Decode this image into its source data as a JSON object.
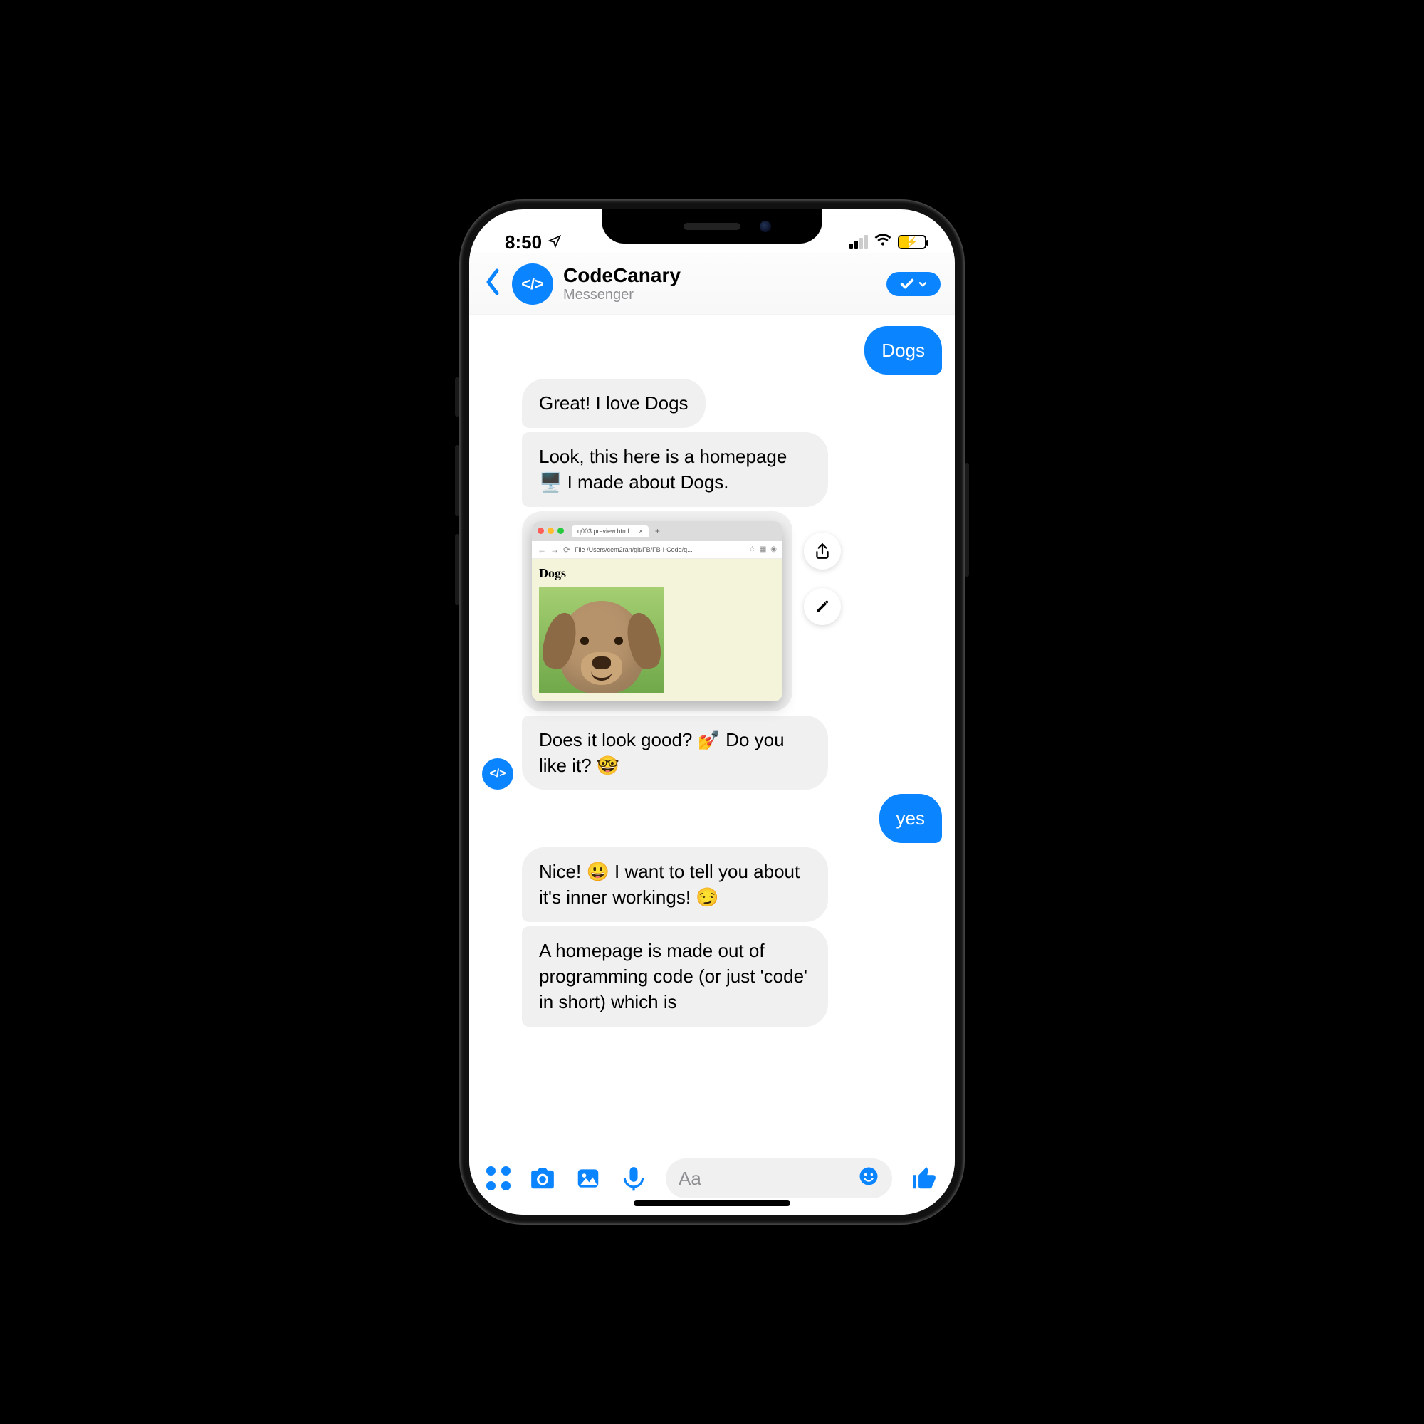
{
  "status": {
    "time": "8:50",
    "location_icon": "location-arrow"
  },
  "header": {
    "title": "CodeCanary",
    "subtitle": "Messenger",
    "avatar_text": "</>"
  },
  "messages": {
    "m0": "Dogs",
    "m1": "Great! I love Dogs",
    "m2": "Look, this here is a homepage 🖥️ I made about Dogs.",
    "m3": "Does it look good? 💅  Do you like it? 🤓",
    "m4": "yes",
    "m5": "Nice! 😃 I want to tell you about it's inner workings! 😏",
    "m6": "A homepage is made out of programming code (or just 'code' in short) which is"
  },
  "preview": {
    "tab_label": "q003.preview.html",
    "url_text": "File  /Users/cem2ran/git/FB/FB-I-Code/q...",
    "page_title": "Dogs"
  },
  "composer": {
    "placeholder": "Aa"
  }
}
